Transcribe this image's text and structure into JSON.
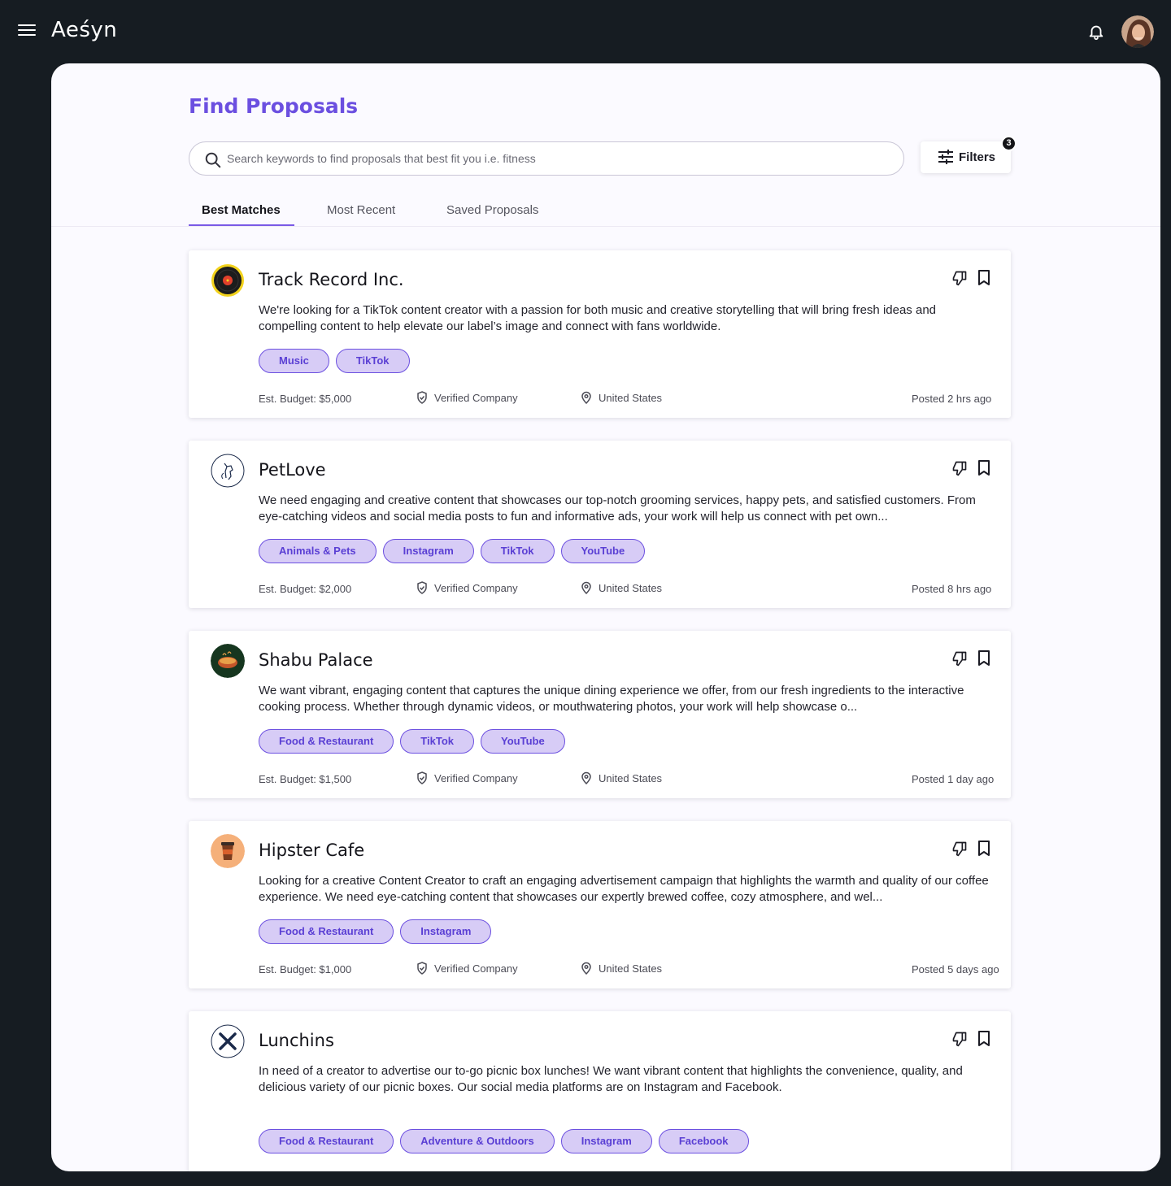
{
  "app": {
    "brand": "Aeśyn",
    "notifications_icon": "bell-icon",
    "menu_icon": "hamburger-menu-icon"
  },
  "page": {
    "title": "Find Proposals",
    "search_placeholder": "Search keywords to find proposals that best fit you i.e. fitness",
    "filters_label": "Filters",
    "filters_count": "3",
    "tabs": [
      {
        "label": "Best Matches",
        "active": true
      },
      {
        "label": "Most Recent",
        "active": false
      },
      {
        "label": "Saved Proposals",
        "active": false
      }
    ]
  },
  "colors": {
    "accent": "#6b4fe0",
    "tag_bg": "#d7ccf6",
    "topbar": "#161c22",
    "panel": "#fbfaff"
  },
  "proposals": [
    {
      "company": "Track Record Inc.",
      "logo": "vinyl-record-logo",
      "description": "We're looking for a TikTok content creator with a passion for both music and creative storytelling that will bring fresh ideas and compelling content to help elevate our label’s image and connect with fans worldwide.",
      "tags": [
        "Music",
        "TikTok"
      ],
      "budget": "Est. Budget: $5,000",
      "verified": "Verified Company",
      "location": "United States",
      "posted": "Posted 2 hrs ago"
    },
    {
      "company": "PetLove",
      "logo": "dog-logo",
      "description": "We need engaging and creative content that showcases our top-notch grooming services, happy pets, and satisfied customers. From eye-catching videos and social media posts to fun and informative ads, your work will help us connect with pet own...",
      "tags": [
        "Animals & Pets",
        "Instagram",
        "TikTok",
        "YouTube"
      ],
      "budget": "Est. Budget: $2,000",
      "verified": "Verified Company",
      "location": "United States",
      "posted": "Posted 8 hrs ago"
    },
    {
      "company": "Shabu Palace",
      "logo": "hotpot-logo",
      "description": "We want vibrant, engaging content that captures the unique dining experience we offer, from our fresh ingredients to the interactive cooking process. Whether through dynamic videos, or mouthwatering photos, your work will help showcase o...",
      "tags": [
        "Food & Restaurant",
        "TikTok",
        "YouTube"
      ],
      "budget": "Est. Budget: $1,500",
      "verified": "Verified Company",
      "location": "United States",
      "posted": "Posted 1 day ago"
    },
    {
      "company": "Hipster Cafe",
      "logo": "coffee-cup-logo",
      "description": "Looking for a creative Content Creator to craft an engaging advertisement campaign that highlights the warmth and quality of our coffee experience. We need eye-catching content that showcases our expertly brewed coffee, cozy atmosphere, and wel...",
      "tags": [
        "Food & Restaurant",
        "Instagram"
      ],
      "budget": "Est. Budget: $1,000",
      "verified": "Verified Company",
      "location": "United States",
      "posted": "Posted 5 days ago"
    },
    {
      "company": "Lunchins",
      "logo": "fork-knife-logo",
      "description": "In need of a creator to advertise our to-go picnic box lunches! We want vibrant content that highlights the convenience, quality, and delicious variety of our picnic boxes. Our social media platforms are on Instagram and Facebook.",
      "tags": [
        "Food & Restaurant",
        "Adventure & Outdoors",
        "Instagram",
        "Facebook"
      ],
      "budget": "",
      "verified": "",
      "location": "",
      "posted": ""
    }
  ]
}
